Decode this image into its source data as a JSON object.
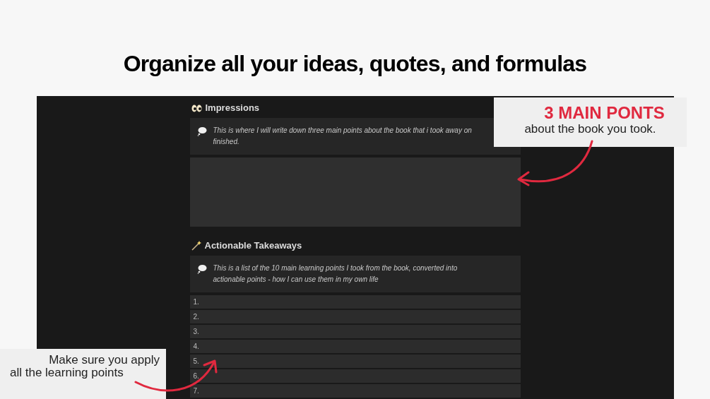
{
  "title": "Organize all your ideas, quotes, and formulas",
  "sections": [
    {
      "heading": "Impressions",
      "callout": [
        "This is where I will write down three main points about the book that i took away on",
        "finished."
      ]
    },
    {
      "heading": "Actionable Takeaways",
      "callout": [
        "This is a list of the 10 main learning points I took from the book, converted into",
        "actionable points - how I can use them in my own life"
      ],
      "items": [
        "1.",
        "2.",
        "3.",
        "4.",
        "5.",
        "6.",
        "7."
      ]
    }
  ],
  "notes": [
    {
      "headline": "3 MAIN PONTS",
      "text": "about the book you took."
    },
    {
      "text": "Make sure you apply all the learning points"
    }
  ]
}
